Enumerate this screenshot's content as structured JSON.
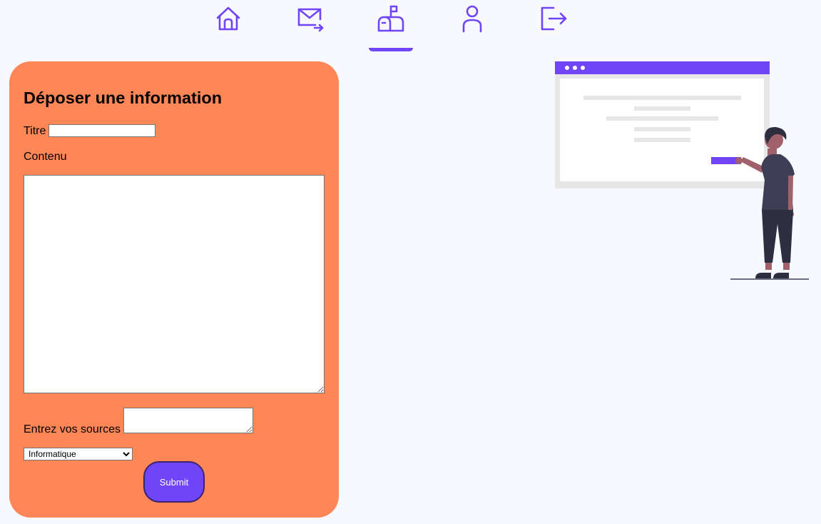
{
  "nav": {
    "items": [
      {
        "icon": "home-icon"
      },
      {
        "icon": "mail-send-icon"
      },
      {
        "icon": "mailbox-icon",
        "active": true
      },
      {
        "icon": "user-icon"
      },
      {
        "icon": "logout-icon"
      }
    ],
    "accent_color": "#7045f7"
  },
  "form": {
    "title": "Déposer une information",
    "titre_label": "Titre",
    "titre_value": "",
    "contenu_label": "Contenu",
    "contenu_value": "",
    "sources_label": "Entrez vos sources",
    "sources_value": "",
    "category_selected": "Informatique",
    "submit_label": "Submit",
    "card_color": "#ff8656",
    "button_color": "#7045f7"
  },
  "illustration": {
    "name": "person-presenting-illustration"
  }
}
